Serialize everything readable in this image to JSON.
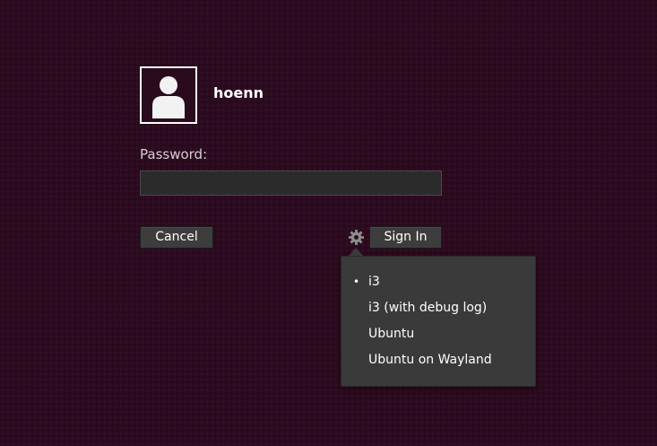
{
  "login": {
    "username": "hoenn",
    "password_label": "Password:",
    "password_value": "",
    "cancel_label": "Cancel",
    "signin_label": "Sign In"
  },
  "icons": {
    "avatar": "user-silhouette-icon",
    "session": "gear-icon",
    "selected": "bullet-icon"
  },
  "session_menu": {
    "selected_index": 0,
    "bullet": "•",
    "items": [
      {
        "label": "i3"
      },
      {
        "label": "i3 (with debug log)"
      },
      {
        "label": "Ubuntu"
      },
      {
        "label": "Ubuntu on Wayland"
      }
    ]
  },
  "colors": {
    "background": "#2c0a1f",
    "button": "#3d3d3d",
    "menu": "#3a3a3a",
    "input": "#2b2b2b"
  }
}
